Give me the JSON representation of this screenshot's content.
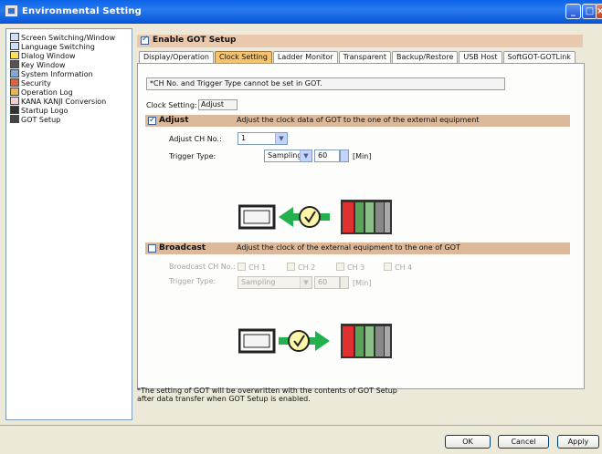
{
  "window": {
    "title": "Environmental Setting"
  },
  "tree": {
    "items": [
      {
        "label": "Screen Switching/Window",
        "icon": "screen-switching-icon"
      },
      {
        "label": "Language Switching",
        "icon": "language-icon"
      },
      {
        "label": "Dialog Window",
        "icon": "dialog-warning-icon"
      },
      {
        "label": "Key Window",
        "icon": "keypad-icon"
      },
      {
        "label": "System Information",
        "icon": "system-info-icon"
      },
      {
        "label": "Security",
        "icon": "security-icon"
      },
      {
        "label": "Operation Log",
        "icon": "operation-log-icon"
      },
      {
        "label": "KANA KANJI Conversion",
        "icon": "kana-kanji-icon"
      },
      {
        "label": "Startup Logo",
        "icon": "startup-logo-icon"
      },
      {
        "label": "GOT Setup",
        "icon": "got-setup-icon",
        "selected": true
      }
    ]
  },
  "enable": {
    "label": "Enable GOT Setup",
    "checked": true
  },
  "tabs": [
    {
      "label": "Display/Operation"
    },
    {
      "label": "Clock Setting",
      "active": true
    },
    {
      "label": "Ladder Monitor"
    },
    {
      "label": "Transparent"
    },
    {
      "label": "Backup/Restore"
    },
    {
      "label": "USB Host"
    },
    {
      "label": "SoftGOT-GOTLink"
    }
  ],
  "clock": {
    "note": "*CH No. and Trigger Type cannot be set in GOT.",
    "setting_label": "Clock Setting:",
    "setting_value": "Adjust",
    "adjust": {
      "title": "Adjust",
      "desc": "Adjust the clock data of GOT to the one of the external equipment",
      "checked": true,
      "ch_label": "Adjust CH No.:",
      "ch_value": "1",
      "trigger_label": "Trigger Type:",
      "trigger_value": "Sampling",
      "interval_value": "60",
      "interval_unit": "[Min]"
    },
    "broadcast": {
      "title": "Broadcast",
      "desc": "Adjust the clock of the external equipment to the one of GOT",
      "checked": false,
      "ch_label": "Broadcast CH No.:",
      "ch_options": [
        "CH 1",
        "CH 2",
        "CH 3",
        "CH 4"
      ],
      "trigger_label": "Trigger Type:",
      "trigger_value": "Sampling",
      "interval_value": "60",
      "interval_unit": "[Min]"
    }
  },
  "footnote": {
    "line1": "*The setting of GOT will be overwritten with the contents of GOT Setup",
    "line2": "after data transfer when GOT Setup is enabled."
  },
  "buttons": {
    "ok": "OK",
    "cancel": "Cancel",
    "apply": "Apply"
  },
  "colors": {
    "titlebar": "#0a62e8",
    "section": "#dcb99a",
    "active_tab": "#f5c36e",
    "arrow_green": "#22b14c"
  }
}
